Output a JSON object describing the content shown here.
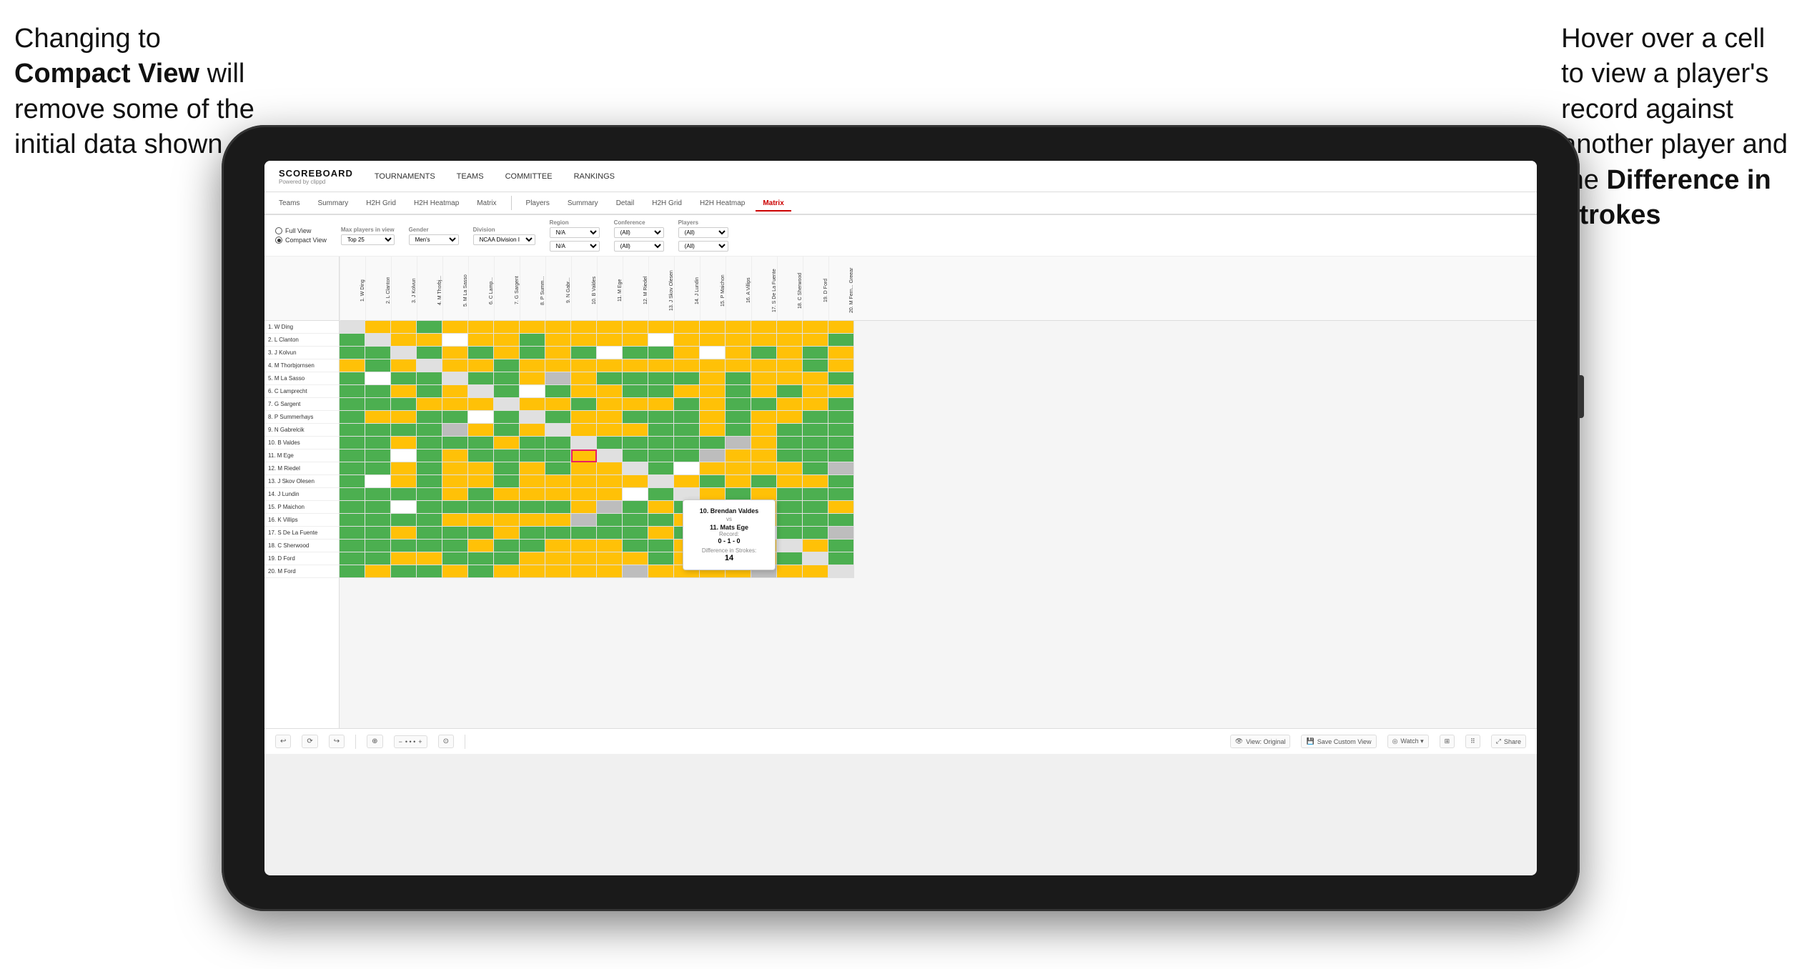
{
  "annotations": {
    "left": {
      "line1": "Changing to",
      "line2_bold": "Compact View",
      "line2_rest": " will",
      "line3": "remove some of the",
      "line4": "initial data shown"
    },
    "right": {
      "line1": "Hover over a cell",
      "line2": "to view a player's",
      "line3": "record against",
      "line4": "another player and",
      "line5_prefix": "the ",
      "line5_bold": "Difference in",
      "line6_bold": "Strokes"
    }
  },
  "nav": {
    "logo": "SCOREBOARD",
    "logo_sub": "Powered by clippd",
    "links": [
      "TOURNAMENTS",
      "TEAMS",
      "COMMITTEE",
      "RANKINGS"
    ]
  },
  "tabs_row1": [
    "Teams",
    "Summary",
    "H2H Grid",
    "H2H Heatmap",
    "Matrix"
  ],
  "tabs_row2": [
    "Players",
    "Summary",
    "Detail",
    "H2H Grid",
    "H2H Heatmap",
    "Matrix"
  ],
  "active_tab_row2": "Matrix",
  "filters": {
    "view_options": [
      "Full View",
      "Compact View"
    ],
    "selected_view": "Compact View",
    "max_players": "Top 25",
    "gender": "Men's",
    "division": "NCAA Division I",
    "region_label": "Region",
    "region_value": "N/A",
    "conference_label": "Conference",
    "conference_value": "(All)",
    "players_label": "Players",
    "players_value": "(All)"
  },
  "players": [
    "1. W Ding",
    "2. L Clanton",
    "3. J Kolvun",
    "4. M Thorbjornsen",
    "5. M La Sasso",
    "6. C Lamprecht",
    "7. G Sargent",
    "8. P Summerhays",
    "9. N Gabrelcik",
    "10. B Valdes",
    "11. M Ege",
    "12. M Riedel",
    "13. J Skov Olesen",
    "14. J Lundin",
    "15. P Maichon",
    "16. K Villips",
    "17. S De La Fuente",
    "18. C Sherwood",
    "19. D Ford",
    "20. M Ford"
  ],
  "col_headers": [
    "1. W Ding",
    "2. L Clanton",
    "3. J Kolvun",
    "4. M Thorbj...",
    "5. M La Sasso",
    "6. C Lamp...",
    "7. G Sargent",
    "8. P Summ...",
    "9. N Gabr...",
    "10. B Valdes",
    "11. M Ege",
    "12. M Riedel",
    "13. J Skov Olesen",
    "14. J Lundin",
    "15. P Maichon",
    "16. K Villips",
    "17. S De La Fuente",
    "18. C Sherwood",
    "19. D Ford",
    "20. M Fern... Greear"
  ],
  "tooltip": {
    "player1": "10. Brendan Valdes",
    "vs": "vs",
    "player2": "11. Mats Ege",
    "record_label": "Record:",
    "record": "0 - 1 - 0",
    "strokes_label": "Difference in Strokes:",
    "strokes": "14"
  },
  "toolbar": {
    "undo": "↩",
    "redo": "↪",
    "history": "⟳",
    "zoom_out": "−",
    "zoom": "• • •",
    "zoom_in": "+",
    "reset": "⊙",
    "view_original": "View: Original",
    "save_custom": "Save Custom View",
    "watch": "Watch ▾",
    "share": "Share",
    "layout": "⊞"
  }
}
